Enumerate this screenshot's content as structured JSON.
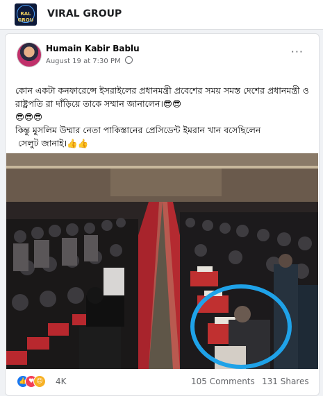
{
  "group": {
    "name": "VIRAL GROUP",
    "logo_text": "RAL GROU"
  },
  "post": {
    "author": "Humain Kabir Bablu",
    "date": "August 19 at 7:30 PM",
    "more": "···",
    "text": "কোন একটা কনফারেন্সে ইসরাইলের প্রধানমন্ত্রী প্রবেশের সময় সমস্ত দেশের প্রধানমন্ত্রী ও রাষ্ট্রপতি রা দাঁড়িয়ে তাকে সম্মান জানালেন।😎😎\n😎😎😎\nকিন্তু মুসলিম উম্মার নেতা পাকিস্তানের প্রেসিডেন্ট ইমরান খান বসেছিলেন\n সেলুট জানাই।👍👍"
  },
  "stats": {
    "reactions": "4K",
    "comments": "105 Comments",
    "shares": "131 Shares"
  },
  "icons": {
    "like": "like-reaction-icon",
    "love": "love-reaction-icon",
    "care": "care-reaction-icon"
  },
  "colors": {
    "like": "#1877f2",
    "love": "#f33e58",
    "care": "#f7b125",
    "highlight_circle": "#1fa2e8"
  }
}
